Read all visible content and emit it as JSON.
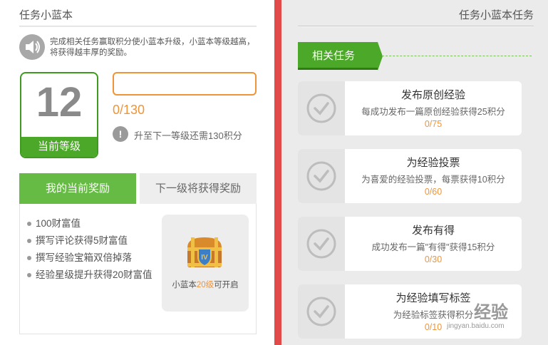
{
  "left": {
    "title": "任务小蓝本",
    "intro": "完成相关任务赢取积分使小蓝本升级，小蓝本等级越高，将获得越丰厚的奖励。",
    "level": {
      "value": "12",
      "label": "当前等级"
    },
    "progress": {
      "text": "0/130",
      "fraction": 0
    },
    "next_info": "升至下一等级还需130积分",
    "tabs": {
      "active": "我的当前奖励",
      "inactive": "下一级将获得奖励"
    },
    "rewards": [
      "100财富值",
      "撰写评论获得5财富值",
      "撰写经验宝箱双倍掉落",
      "经验星级提升获得20财富值"
    ],
    "chest": {
      "caption_pre": "小蓝本",
      "caption_level": "20级",
      "caption_post": "可开启"
    }
  },
  "right": {
    "title": "任务小蓝本任务",
    "section_label": "相关任务",
    "tasks": [
      {
        "title": "发布原创经验",
        "desc": "每成功发布一篇原创经验获得25积分",
        "progress": "0/75"
      },
      {
        "title": "为经验投票",
        "desc": "为喜爱的经验投票，每票获得10积分",
        "progress": "0/60"
      },
      {
        "title": "发布有得",
        "desc": "成功发布一篇\"有得\"获得15积分",
        "progress": "0/30"
      },
      {
        "title": "为经验填写标签",
        "desc": "为经验标签获得积分",
        "progress": "0/10"
      }
    ]
  },
  "watermark": {
    "text": "经验",
    "url": "jingyan.baidu.com"
  },
  "colors": {
    "accent_green": "#4ca829",
    "accent_orange": "#f0943a",
    "divider_red": "#e24a4a"
  },
  "icons": [
    "speaker-icon",
    "info-icon",
    "treasure-chest-icon",
    "check-circle-icon"
  ]
}
